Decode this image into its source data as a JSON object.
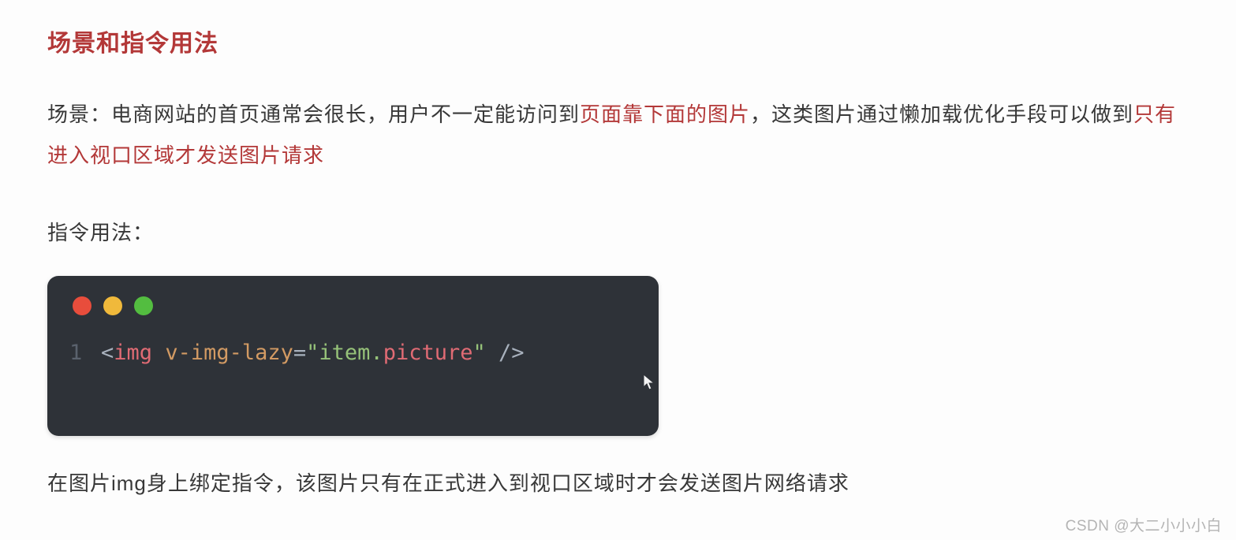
{
  "heading": "场景和指令用法",
  "para1_pre": "场景：电商网站的首页通常会很长，用户不一定能访问到",
  "para1_hl1": "页面靠下面的图片",
  "para1_mid": "，这类图片通过懒加载优化手段可以做到",
  "para1_hl2": "只有进入视口区域才发送图片请求",
  "para2": "指令用法：",
  "code": {
    "line_number": "1",
    "angle_open": "<",
    "tag": "img",
    "space1": " ",
    "attr": "v-img-lazy",
    "eq": "=",
    "quote1": "\"",
    "str_obj": "item",
    "dot": ".",
    "str_prop": "picture",
    "quote2": "\"",
    "space2": " ",
    "slash_close": "/>"
  },
  "footer": "在图片img身上绑定指令，该图片只有在正式进入到视口区域时才会发送图片网络请求",
  "watermark": "CSDN @大二小小小白"
}
